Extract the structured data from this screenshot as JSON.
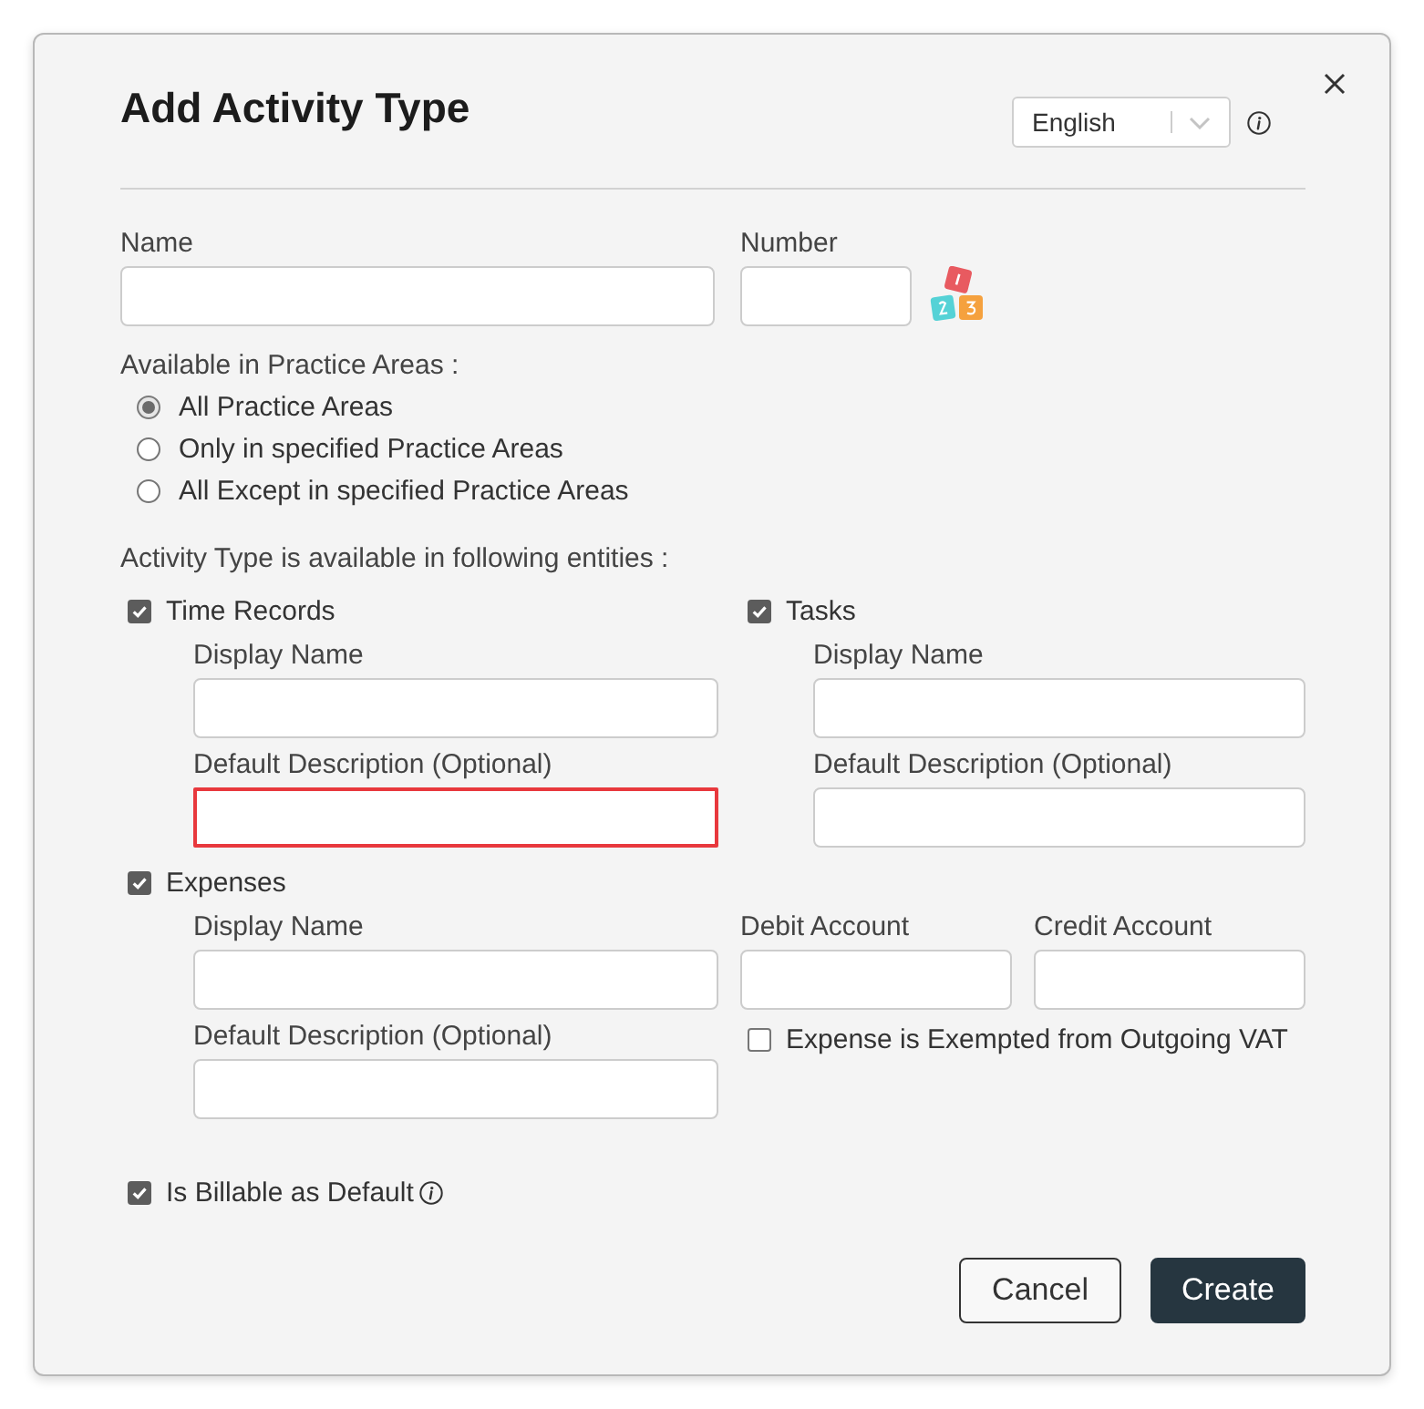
{
  "dialog": {
    "title": "Add Activity Type"
  },
  "language": {
    "value": "English"
  },
  "name_field": {
    "label": "Name",
    "invalid": false
  },
  "number_field": {
    "label": "Number",
    "invalid": false
  },
  "practice_areas": {
    "label": "Available in Practice Areas :",
    "options": [
      {
        "label": "All Practice Areas",
        "selected": true
      },
      {
        "label": "Only in specified Practice Areas",
        "selected": false
      },
      {
        "label": "All Except in specified Practice Areas",
        "selected": false
      }
    ]
  },
  "entities": {
    "label": "Activity Type is available in following entities :",
    "items": [
      {
        "kind": "basic",
        "label": "Time Records",
        "checked": true,
        "fields": [
          {
            "label": "Display Name",
            "invalid": false
          },
          {
            "label": "Default Description (Optional)",
            "invalid": true
          }
        ]
      },
      {
        "kind": "basic",
        "label": "Tasks",
        "checked": true,
        "fields": [
          {
            "label": "Display Name",
            "invalid": false
          },
          {
            "label": "Default Description (Optional)",
            "invalid": false
          }
        ]
      },
      {
        "kind": "accounting",
        "label": "Expenses",
        "checked": true,
        "fields": [
          {
            "label": "Display Name",
            "invalid": false
          },
          {
            "label": "Default Description (Optional)",
            "invalid": false
          }
        ],
        "accounts": [
          {
            "label": "Debit Account",
            "invalid": false
          },
          {
            "label": "Credit Account",
            "invalid": false
          }
        ],
        "vat_exempt": {
          "label": "Expense is Exempted from Outgoing VAT",
          "checked": false
        }
      }
    ]
  },
  "billable": {
    "label": "Is Billable as Default",
    "checked": true
  },
  "buttons": [
    {
      "label": "Cancel",
      "kind": "secondary"
    },
    {
      "label": "Create",
      "kind": "primary"
    }
  ]
}
